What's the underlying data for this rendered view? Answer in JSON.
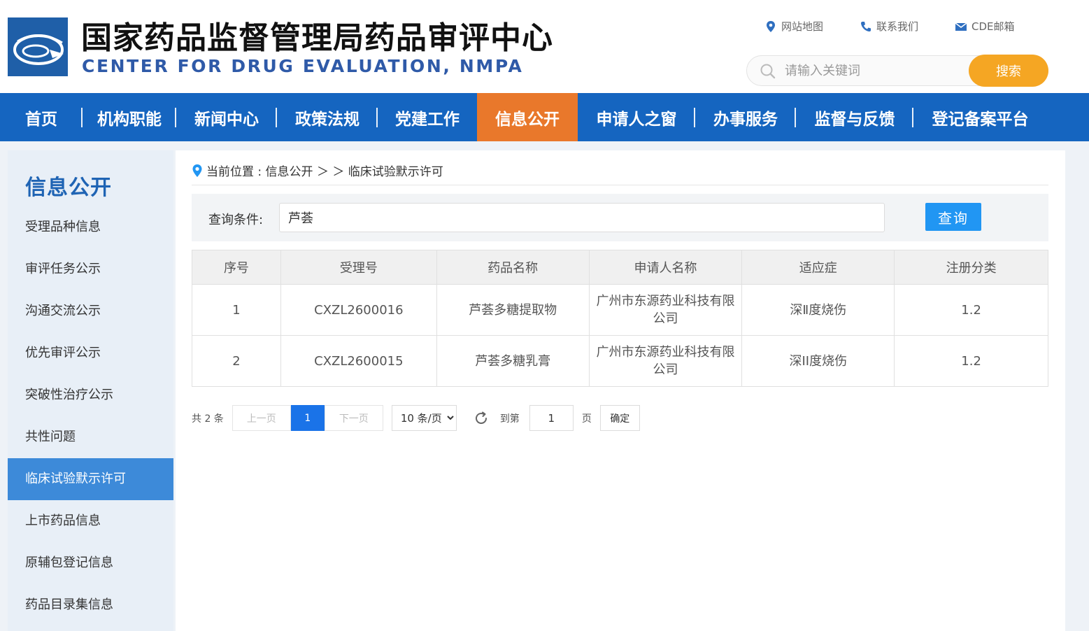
{
  "header": {
    "title_cn": "国家药品监督管理局药品审评中心",
    "title_en": "CENTER FOR DRUG EVALUATION, NMPA",
    "links": [
      {
        "label": "网站地图",
        "icon": "location-pin-icon"
      },
      {
        "label": "联系我们",
        "icon": "phone-icon"
      },
      {
        "label": "CDE邮箱",
        "icon": "mail-icon"
      }
    ],
    "search_placeholder": "请输入关键词",
    "search_button": "搜索"
  },
  "nav": {
    "items": [
      "首页",
      "机构职能",
      "新闻中心",
      "政策法规",
      "党建工作",
      "信息公开",
      "申请人之窗",
      "办事服务",
      "监督与反馈",
      "登记备案平台"
    ],
    "active": "信息公开"
  },
  "sidebar": {
    "title": "信息公开",
    "items": [
      "受理品种信息",
      "审评任务公示",
      "沟通交流公示",
      "优先审评公示",
      "突破性治疗公示",
      "共性问题",
      "临床试验默示许可",
      "上市药品信息",
      "原辅包登记信息",
      "药品目录集信息"
    ],
    "active": "临床试验默示许可"
  },
  "breadcrumb": {
    "text": "当前位置 : 信息公开 ＞ ＞ 临床试验默示许可"
  },
  "query": {
    "label": "查询条件:",
    "value": "芦荟",
    "button": "查询"
  },
  "table": {
    "headers": [
      "序号",
      "受理号",
      "药品名称",
      "申请人名称",
      "适应症",
      "注册分类"
    ],
    "rows": [
      [
        "1",
        "CXZL2600016",
        "芦荟多糖提取物",
        "广州市东源药业科技有限公司",
        "深Ⅱ度烧伤",
        "1.2"
      ],
      [
        "2",
        "CXZL2600015",
        "芦荟多糖乳膏",
        "广州市东源药业科技有限公司",
        "深II度烧伤",
        "1.2"
      ]
    ]
  },
  "pager": {
    "total": "共 2 条",
    "prev": "上一页",
    "current": "1",
    "next": "下一页",
    "page_size": "10 条/页",
    "goto_label": "到第",
    "goto_value": "1",
    "page_label": "页",
    "confirm": "确定"
  },
  "colors": {
    "nav_bg": "#1565c0",
    "nav_active": "#e9782b",
    "search_button": "#f5a623",
    "sidebar_active": "#3d8ad9",
    "query_button": "#2196f3",
    "pager_current": "#1a73e8"
  }
}
